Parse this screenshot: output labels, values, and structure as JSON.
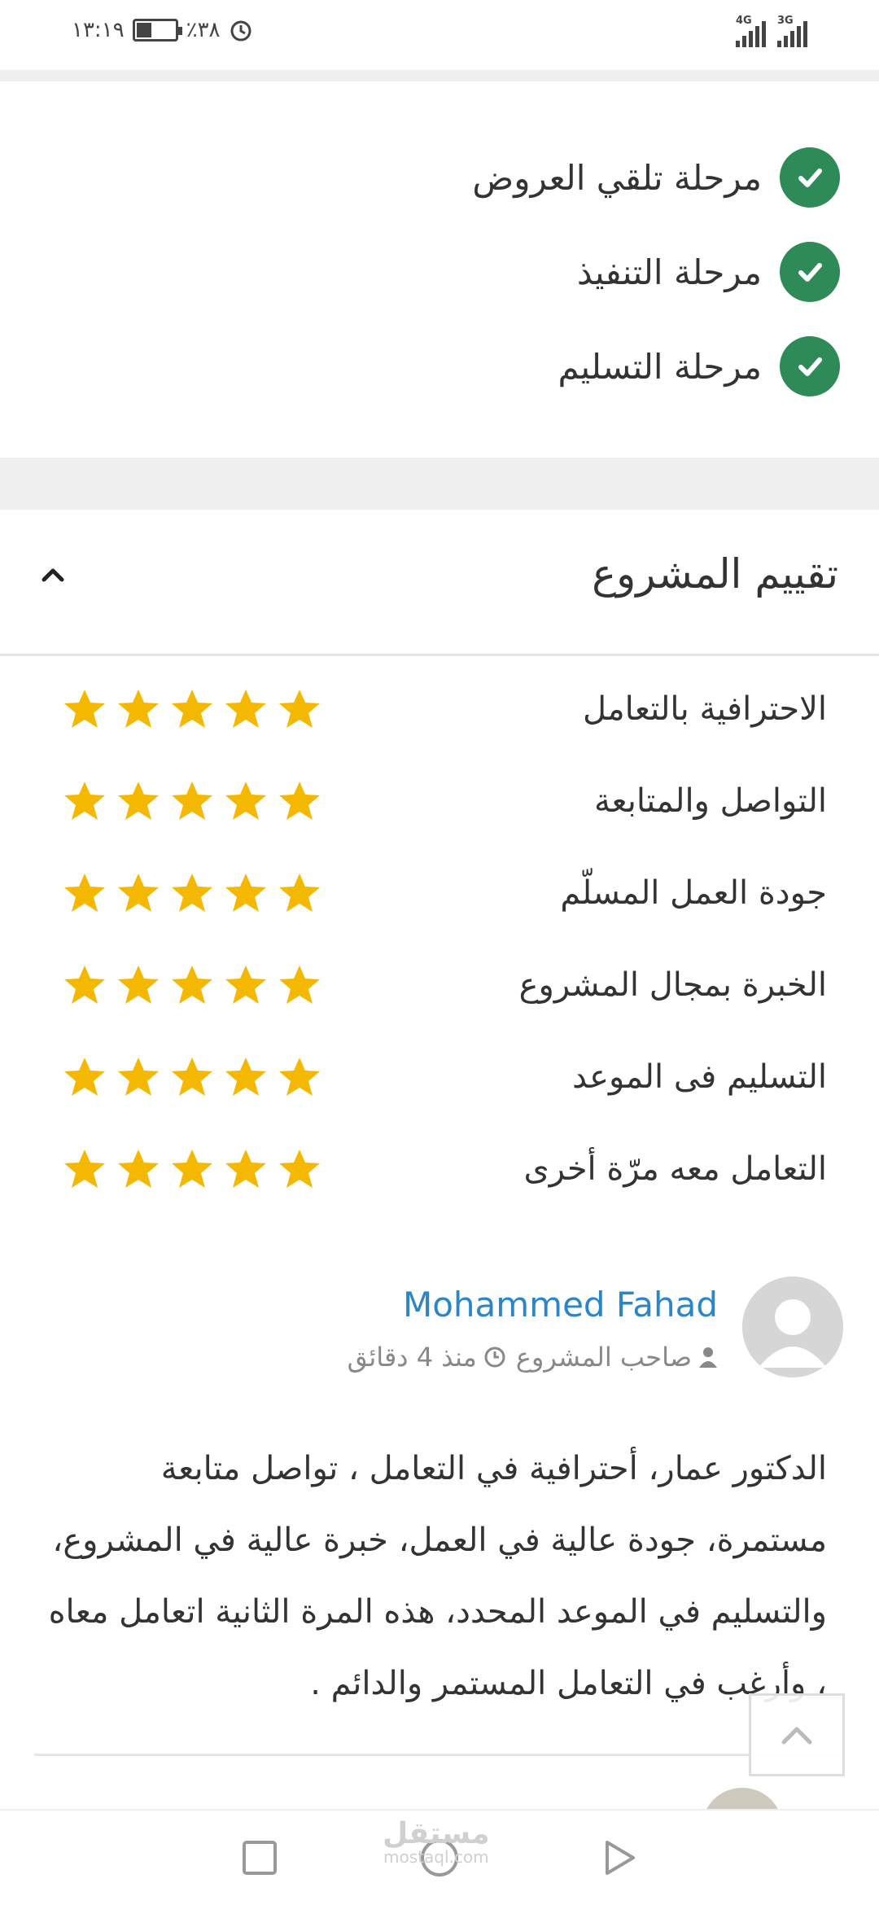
{
  "status_bar": {
    "time": "١٣:١٩",
    "battery": "٪٣٨",
    "network_1": "4G",
    "network_2": "3G"
  },
  "stages": [
    {
      "label": "مرحلة تلقي العروض",
      "done": true
    },
    {
      "label": "مرحلة التنفيذ",
      "done": true
    },
    {
      "label": "مرحلة التسليم",
      "done": true
    }
  ],
  "rating_section": {
    "title": "تقييم المشروع",
    "star_color": "#f5b800",
    "criteria": [
      {
        "label": "الاحترافية بالتعامل",
        "stars": 5
      },
      {
        "label": "التواصل والمتابعة",
        "stars": 5
      },
      {
        "label": "جودة العمل المسلّم",
        "stars": 5
      },
      {
        "label": "الخبرة بمجال المشروع",
        "stars": 5
      },
      {
        "label": "التسليم فى الموعد",
        "stars": 5
      },
      {
        "label": "التعامل معه مرّة أخرى",
        "stars": 5
      }
    ]
  },
  "review": {
    "name": "Mohammed Fahad",
    "role": "صاحب المشروع",
    "time": "منذ 4 دقائق",
    "text": "الدكتور عمار، أحترافية في التعامل ، تواصل متابعة مستمرة، جودة عالية في العمل، خبرة عالية في المشروع، والتسليم في الموعد المحدد، هذه المرة الثانية اتعامل معاه ، وأرغب في التعامل المستمر والدائم ."
  },
  "watermark": {
    "arabic": "مستقل",
    "latin": "mostaql.com"
  },
  "colors": {
    "check_green": "#2e8b57",
    "link_blue": "#2a86c7"
  }
}
